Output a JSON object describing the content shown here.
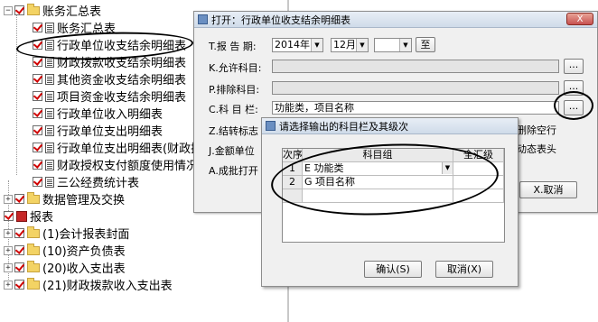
{
  "tree": {
    "items": [
      {
        "label": "账务汇总表"
      },
      {
        "label": "账务汇总表"
      },
      {
        "label": "行政单位收支结余明细表"
      },
      {
        "label": "财政拨款收支结余明细表"
      },
      {
        "label": "其他资金收支结余明细表"
      },
      {
        "label": "项目资金收支结余明细表"
      },
      {
        "label": "行政单位收入明细表"
      },
      {
        "label": "行政单位支出明细表"
      },
      {
        "label": "行政单位支出明细表(财政拨"
      },
      {
        "label": "财政授权支付额度使用情况表"
      },
      {
        "label": "三公经费统计表"
      },
      {
        "label": "数据管理及交换"
      },
      {
        "label": "报表"
      },
      {
        "label": "(1)会计报表封面"
      },
      {
        "label": "(10)资产负债表"
      },
      {
        "label": "(20)收入支出表"
      },
      {
        "label": "(21)财政拨款收入支出表"
      }
    ]
  },
  "dialog": {
    "title": "打开：行政单位收支结余明细表",
    "close_label": "X",
    "t_label": "T.报 告 期:",
    "year_value": "2014年",
    "month_value": "12月",
    "to_label": "至",
    "k_label": "K.允许科目:",
    "p_label": "P.排除科目:",
    "c_label": "C.科 目 栏:",
    "c_value": "功能类，项目名称",
    "browse_label": "...",
    "z_label": "Z.结转标志",
    "j_label": "J.金额单位",
    "a_label": "A.成批打开",
    "del_empty_label": "删除空行",
    "dyn_header_label": "动态表头",
    "cancel_label": "X.取消"
  },
  "subdialog": {
    "title": "请选择输出的科目栏及其级次",
    "col_seq": "次序",
    "col_group": "科目组",
    "col_level": "全汇级",
    "rows": [
      {
        "seq": "1",
        "group": "E 功能类"
      },
      {
        "seq": "2",
        "group": "G 项目名称"
      }
    ],
    "ok_label": "确认(S)",
    "cancel_label": "取消(X)"
  }
}
